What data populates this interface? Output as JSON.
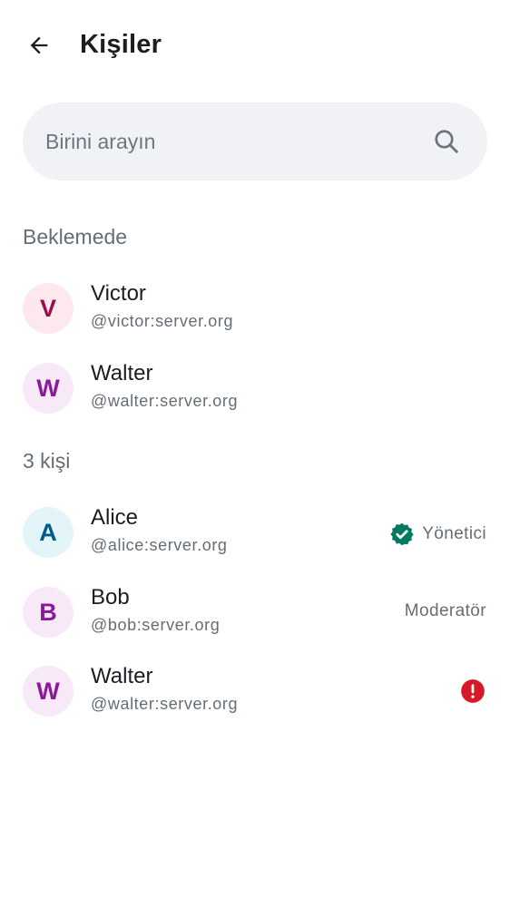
{
  "header": {
    "title": "Kişiler",
    "back_icon": "arrow-left-icon"
  },
  "search": {
    "placeholder": "Birini arayın",
    "value": "",
    "icon": "search-icon"
  },
  "sections": {
    "pending": {
      "title": "Beklemede",
      "members": [
        {
          "initial": "V",
          "name": "Victor",
          "user_id": "@victor:server.org",
          "avatar_bg": "#fde8ee",
          "avatar_fg": "#9b0e4c"
        },
        {
          "initial": "W",
          "name": "Walter",
          "user_id": "@walter:server.org",
          "avatar_bg": "#f8e9f8",
          "avatar_fg": "#8a1a9b"
        }
      ]
    },
    "joined": {
      "title": "3 kişi",
      "members": [
        {
          "initial": "A",
          "name": "Alice",
          "user_id": "@alice:server.org",
          "role": "Yönetici",
          "role_icon": "verified-badge-icon",
          "avatar_bg": "#e3f5f8",
          "avatar_fg": "#005b8a"
        },
        {
          "initial": "B",
          "name": "Bob",
          "user_id": "@bob:server.org",
          "role": "Moderatör",
          "avatar_bg": "#f8e9f8",
          "avatar_fg": "#8a1a9b"
        },
        {
          "initial": "W",
          "name": "Walter",
          "user_id": "@walter:server.org",
          "status_icon": "error-icon",
          "avatar_bg": "#f8e9f8",
          "avatar_fg": "#8a1a9b"
        }
      ]
    }
  },
  "colors": {
    "verified": "#007a61",
    "error": "#d51928",
    "secondary_text": "#656d77",
    "search_bg": "#f0f2f5"
  }
}
